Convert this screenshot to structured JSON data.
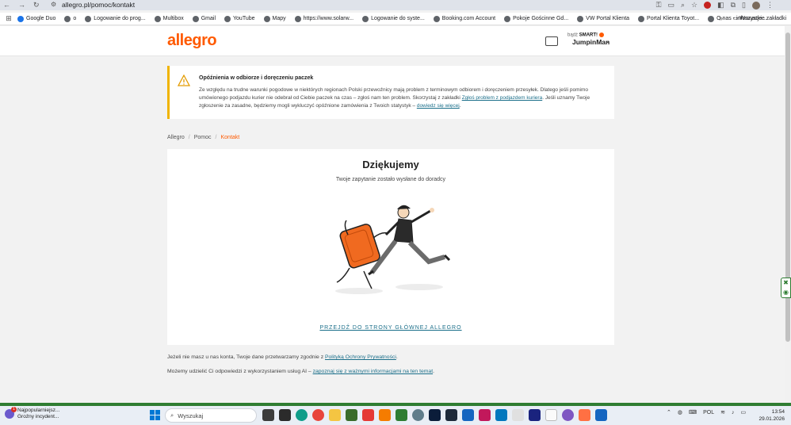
{
  "browser": {
    "url": "allegro.pl/pomoc/kontakt",
    "bookmarks": [
      "Google Duo",
      "o",
      "Logowanie do prog...",
      "Multibox",
      "Gmail",
      "YouTube",
      "Mapy",
      "https://www.solarw...",
      "Logowanie do syste...",
      "Booking.com Account",
      "Pokoje Gościnne Gd...",
      "VW Portal Klienta",
      "Portal Klienta Toyot...",
      "O nas - informacje..."
    ],
    "all_bookmarks": "Wszystkie zakładki"
  },
  "header": {
    "logo": "allegro",
    "smart_prefix": "bądź",
    "smart_label": "SMART!",
    "username": "JumpinMan"
  },
  "alert": {
    "title": "Opóźnienia w odbiorze i doręczeniu paczek",
    "body_1": "Ze względu na trudne warunki pogodowe w niektórych regionach Polski przewoźnicy mają problem z terminowym odbiorem i doręczeniem przesyłek. Dlatego jeśli pomimo umówionego podjazdu kurier nie odebrał od Ciebie paczek na czas – zgłoś nam ten problem. Skorzystaj z zakładki ",
    "link_1": "Zgłoś problem z podjazdem kuriera",
    "body_2": ". Jeśli uznamy Twoje zgłoszenie za zasadne, będziemy mogli wykluczyć opóźnione zamówienia z Twoich statystyk – ",
    "link_2": "dowiedz się więcej",
    "body_3": "."
  },
  "breadcrumb": [
    "Allegro",
    "Pomoc",
    "Kontakt"
  ],
  "main": {
    "title": "Dziękujemy",
    "subtitle": "Twoje zapytanie zostało wysłane do doradcy",
    "home_link": "PRZEJDŹ DO STRONY GŁÓWNEJ ALLEGRO"
  },
  "footer_notes": {
    "note1_text": "Jeżeli nie masz u nas konta, Twoje dane przetwarzamy zgodnie z ",
    "note1_link": "Polityką Ochrony Prywatności",
    "note1_end": ".",
    "note2_text": "Możemy udzielić Ci odpowiedzi z wykorzystaniem usług AI – ",
    "note2_link": "zapoznaj się z ważnymi informacjami na ten temat",
    "note2_end": "."
  },
  "taskbar": {
    "news_title": "Najpopularniejsz...",
    "news_sub": "Groźny incydent...",
    "news_badge": "1",
    "search_placeholder": "Wyszukaj",
    "lang": "POL",
    "time": "13:54",
    "date": "29.01.2026"
  },
  "colors": {
    "brand": "#ff5a00",
    "link": "#1b6f8a",
    "alert_border": "#f0b400"
  }
}
